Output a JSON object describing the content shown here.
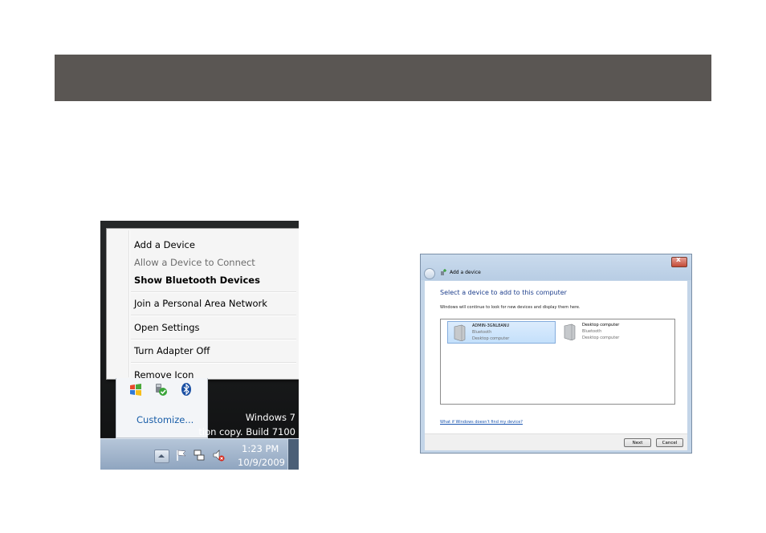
{
  "context_menu": {
    "items": [
      {
        "label": "Add a Device"
      },
      {
        "label": "Allow a Device to Connect"
      },
      {
        "label": "Show Bluetooth Devices"
      },
      {
        "label": "Join a Personal Area Network"
      },
      {
        "label": "Open Settings"
      },
      {
        "label": "Turn Adapter Off"
      },
      {
        "label": "Remove Icon"
      }
    ]
  },
  "tray_popup": {
    "customize_label": "Customize...",
    "icons": [
      "windows-flag-icon",
      "network-shield-icon",
      "bluetooth-icon"
    ]
  },
  "desktop": {
    "os_name": "Windows 7",
    "build_text": "tion copy. Build 7100"
  },
  "taskbar": {
    "time": "1:23 PM",
    "date": "10/9/2009",
    "icons": [
      "show-hidden-icons-icon",
      "action-center-flag-icon",
      "network-icon",
      "volume-muted-icon"
    ]
  },
  "add_device_dialog": {
    "title": "Add a device",
    "heading": "Select a device to add to this computer",
    "subtext": "Windows will continue to look for new devices and display them here.",
    "devices": [
      {
        "name": "ADMIN-3GNL8ANU",
        "connection": "Bluetooth",
        "kind": "Desktop computer",
        "selected": true
      },
      {
        "name": "Desktop computer",
        "connection": "Bluetooth",
        "kind": "Desktop computer",
        "selected": false
      }
    ],
    "help_link": "What if Windows doesn't find my device?",
    "next_label": "Next",
    "cancel_label": "Cancel",
    "close_label": "x"
  },
  "colors": {
    "header_bar": "#5a5653",
    "heading_blue": "#1e3f8c",
    "link_blue": "#1a55b0",
    "selection": "#c4e0fb"
  }
}
